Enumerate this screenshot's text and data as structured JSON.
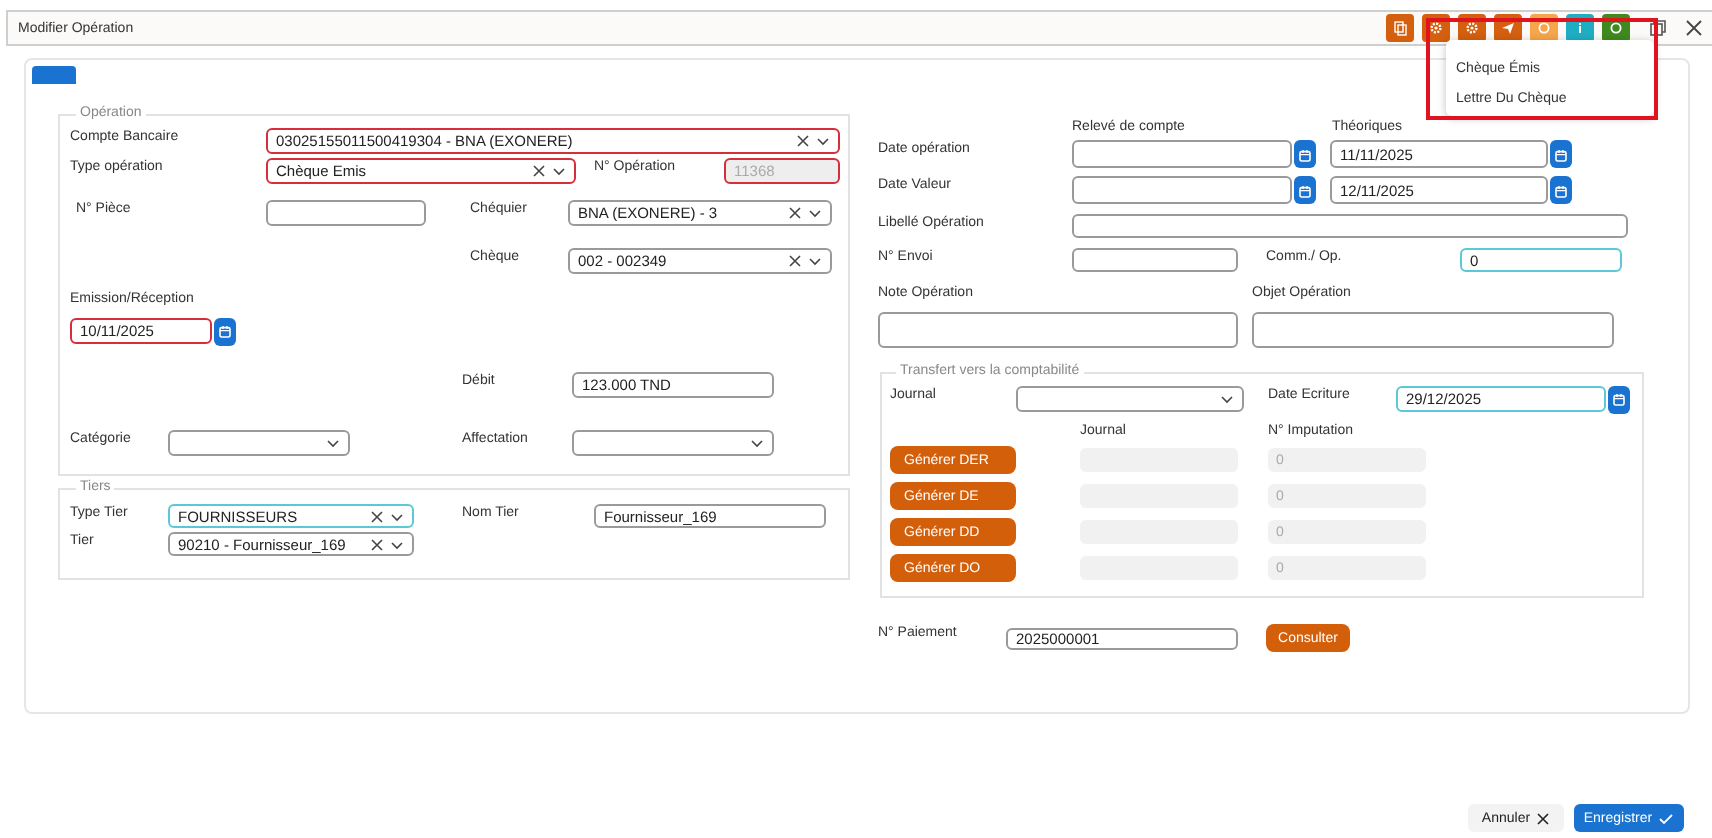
{
  "window": {
    "title": "Modifier Opération"
  },
  "toolbar": [
    {
      "kind": "documents",
      "color": "#d35f0f"
    },
    {
      "kind": "gear",
      "color": "#d35f0f"
    },
    {
      "kind": "gear",
      "color": "#d35f0f"
    },
    {
      "kind": "send",
      "color": "#d35f0f"
    },
    {
      "kind": "circle",
      "color": "#f5a54a"
    },
    {
      "kind": "info",
      "color": "#1eaec4"
    },
    {
      "kind": "circle",
      "color": "#3f8a1f"
    }
  ],
  "menu": {
    "highlighted": true,
    "items": [
      "Chèque Émis",
      "Lettre Du Chèque"
    ]
  },
  "tabs": [
    {
      "selected": true
    }
  ],
  "operation": {
    "legend": "Opération",
    "fields": [
      {
        "label": "Compte Bancaire",
        "kind": "select",
        "value": "03025155011500419304 - BNA (EXONERE)",
        "invalid": true,
        "focused": false,
        "disabled": false
      },
      {
        "label": "Type opération",
        "kind": "select",
        "value": "Chèque Emis",
        "invalid": true,
        "focused": false,
        "disabled": false
      },
      {
        "label": "N° Opération",
        "kind": "text",
        "value": "11368",
        "invalid": true,
        "focused": false,
        "disabled": true
      },
      {
        "label": "N° Pièce",
        "kind": "text",
        "invalid": false,
        "focused": false,
        "disabled": false
      },
      {
        "label": "Chéquier",
        "kind": "select",
        "value": "BNA (EXONERE) - 3",
        "invalid": false,
        "focused": false,
        "disabled": false
      },
      {
        "label": "Chèque",
        "kind": "select",
        "value": "002 - 002349",
        "invalid": false,
        "focused": false,
        "disabled": false
      },
      {
        "label": "Emission/Réception",
        "kind": "date",
        "value": "10/11/2025",
        "invalid": true,
        "focused": false,
        "disabled": false
      },
      {
        "label": "Débit",
        "kind": "text",
        "value": "123.000 TND",
        "invalid": false,
        "focused": false,
        "disabled": false
      },
      {
        "label": "Catégorie",
        "kind": "select",
        "invalid": false,
        "focused": false,
        "disabled": false
      },
      {
        "label": "Affectation",
        "kind": "select",
        "invalid": false,
        "focused": false,
        "disabled": false
      }
    ]
  },
  "tiers": {
    "legend": "Tiers",
    "fields": [
      {
        "label": "Type Tier",
        "kind": "select",
        "value": "FOURNISSEURS",
        "invalid": false,
        "focused": true,
        "disabled": false
      },
      {
        "label": "Nom Tier",
        "kind": "text",
        "value": "Fournisseur_169",
        "invalid": false,
        "focused": false,
        "disabled": false
      },
      {
        "label": "Tier",
        "kind": "select",
        "value": "90210 - Fournisseur_169",
        "invalid": false,
        "focused": false,
        "disabled": false
      }
    ]
  },
  "details": {
    "columns": [
      "Relevé de compte",
      "Théoriques"
    ],
    "fields": [
      {
        "label": "Date opération",
        "kind": "date",
        "invalid": false,
        "focused": false,
        "disabled": false
      },
      {
        "kind": "date",
        "value": "11/11/2025",
        "invalid": false,
        "focused": false,
        "disabled": false
      },
      {
        "label": "Date Valeur",
        "kind": "date",
        "invalid": false,
        "focused": false,
        "disabled": false
      },
      {
        "kind": "date",
        "value": "12/11/2025",
        "invalid": false,
        "focused": false,
        "disabled": false
      },
      {
        "label": "Libellé Opération",
        "kind": "text",
        "invalid": false,
        "focused": false,
        "disabled": false
      },
      {
        "label": "N° Envoi",
        "kind": "text",
        "invalid": false,
        "focused": false,
        "disabled": false
      },
      {
        "label": "Comm./ Op.",
        "kind": "text",
        "value": "0",
        "invalid": false,
        "focused": true,
        "disabled": false
      },
      {
        "label": "Note Opération",
        "kind": "textarea",
        "invalid": false,
        "focused": false,
        "disabled": false
      },
      {
        "label": "Objet Opération",
        "kind": "textarea",
        "invalid": false,
        "focused": false,
        "disabled": false
      }
    ]
  },
  "transfer": {
    "legend": "Transfert vers la comptabilité",
    "fields": [
      {
        "label": "Journal",
        "kind": "select",
        "invalid": false,
        "focused": false,
        "disabled": false
      },
      {
        "label": "Date Ecriture",
        "kind": "date",
        "value": "29/12/2025",
        "invalid": false,
        "focused": true,
        "disabled": false
      }
    ],
    "columns": [
      "Journal",
      "N° Imputation"
    ],
    "rows": [
      {
        "action": "Générer DER",
        "imputation": "0"
      },
      {
        "action": "Générer DE",
        "imputation": "0"
      },
      {
        "action": "Générer DD",
        "imputation": "0"
      },
      {
        "action": "Générer DO",
        "imputation": "0"
      }
    ]
  },
  "payment": {
    "label": "N° Paiement",
    "value": "2025000001",
    "action": "Consulter"
  },
  "footer": {
    "buttons": [
      {
        "kind": "cancel",
        "label": "Annuler"
      },
      {
        "kind": "save",
        "label": "Enregistrer"
      }
    ]
  }
}
